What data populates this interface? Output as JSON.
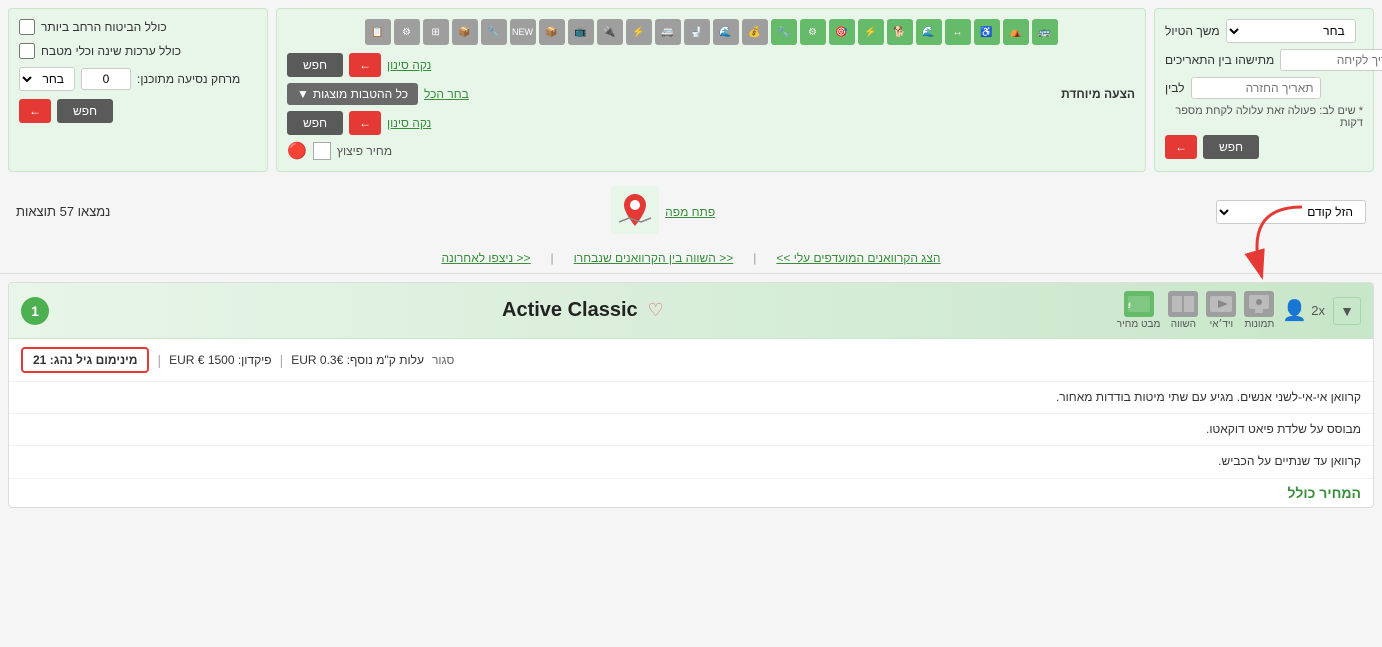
{
  "topSection": {
    "leftPanel": {
      "routeLabel": "משך הטיול",
      "routeSelect": "בחר",
      "datesLabel": "מתישהו בין התאריכים",
      "dateFrom": "תאריך לקיחה",
      "dateTo": "תאריך החזרה",
      "toLabel": "לבין",
      "noteText": "* שים לב: פעולה זאת עלולה לקחת מספר דקות",
      "searchBtn": "חפש",
      "backBtn": "←"
    },
    "middlePanel": {
      "clearSignIn": "נקה סינון",
      "allOptions": "כל ההטבות מוצגות",
      "specialLabel": "הצעה מיוחדת",
      "allLink": "בחר הכל",
      "searchBtn": "חפש",
      "backBtn": "←",
      "clearSignIn2": "נקה סינון",
      "priceLabel": "מחיר פיצוץ"
    },
    "rightPanel": {
      "insuranceLabel": "כולל הביטוח הרחב ביותר",
      "kitchenLabel": "כולל ערכות שינה וכלי מטבח",
      "distanceLabel": "מרחק נסיעה מתוכנן:",
      "distanceValue": "0",
      "distanceSelect": "בחר",
      "searchBtn": "חפש",
      "backBtn": "←"
    }
  },
  "resultsSection": {
    "sortLabel": "הזל קודם",
    "mapLabel": "פתח מפה",
    "resultsCount": "נמצאו 57 תוצאות"
  },
  "navLinks": {
    "link1": "<< ניצפו לאחרונה",
    "link2": "<< השווה בין הקרוואנים שנבחרו",
    "link3": "הצג הקרוואנים המועדפים עלי >>"
  },
  "card": {
    "number": "1",
    "name": "Active Classic",
    "expandLabel": "▼",
    "actionPhotos": "תמונות",
    "actionVideo": "ויד׳אי",
    "actionCompare": "השווה",
    "actionPriceFocus": "מבט מחיר",
    "persons": "2x",
    "detailBadge": "מינימום גיל נהג: 21",
    "separator1": "|",
    "depositLabel": "פיקדון: 1500 € EUR",
    "separator2": "|",
    "extraKmLabel": "עלות ק\"מ נוסף: EUR 0.3€",
    "closedLabel": "סגור",
    "desc1": "קרוואן אי-אי-לשני אנשים. מגיע עם שתי מיטות בודדות מאחור.",
    "desc2": "מבוסס על שלדת פיאט דוקאטו.",
    "desc3": "קרוואן עד שנתיים על הכביש.",
    "totalPriceLabel": "המחיר כולל"
  },
  "icons": {
    "rows": [
      [
        "🚌",
        "🏕",
        "♿",
        "↔",
        "🌊",
        "🐕",
        "⚡",
        "🎯",
        "⚙",
        "🔧"
      ],
      [
        "💰",
        "🌊",
        "🚽",
        "🚌",
        "⚡",
        "🔌",
        "📺",
        "🔲",
        "NEW",
        "🔧",
        "📦"
      ],
      [
        "🔲",
        "🔧",
        "📦"
      ]
    ]
  }
}
